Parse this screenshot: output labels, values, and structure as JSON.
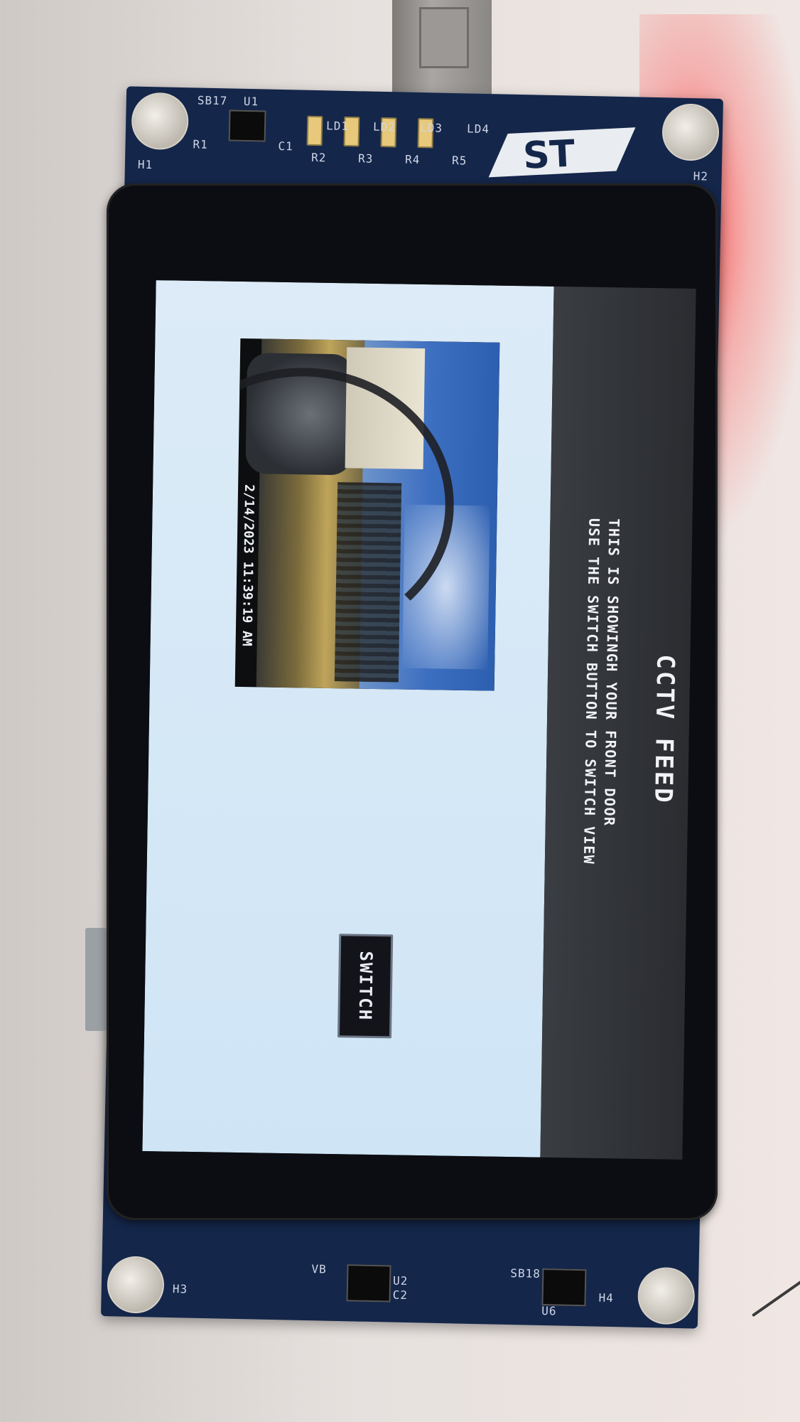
{
  "board_silk": {
    "h1": "H1",
    "h2": "H2",
    "h3": "H3",
    "h4": "H4",
    "sb17": "SB17",
    "u1": "U1",
    "r1": "R1",
    "c1": "C1",
    "ld1": "LD1",
    "ld2": "LD2",
    "ld3": "LD3",
    "ld4": "LD4",
    "r2": "R2",
    "r3": "R3",
    "r4": "R4",
    "r5": "R5",
    "u2": "U2",
    "c2": "C2",
    "u6": "U6",
    "sb18": "SB18",
    "vb": "VB",
    "logo_text": "ST"
  },
  "screen": {
    "title": "CCTV FEED",
    "line1": "THIS IS SHOWINGH YOUR FRONT DOOR",
    "line2": "USE THE SWITCH BUTTON TO SWITCH VIEW",
    "camera": {
      "timestamp": "2/14/2023 11:39:19 AM"
    },
    "switch_label": "SWITCH"
  },
  "colors": {
    "board": "#14264a",
    "screen_bg": "#cfe5f6",
    "header_bg": "#2a2c30",
    "led_glow": "#ff2828"
  }
}
